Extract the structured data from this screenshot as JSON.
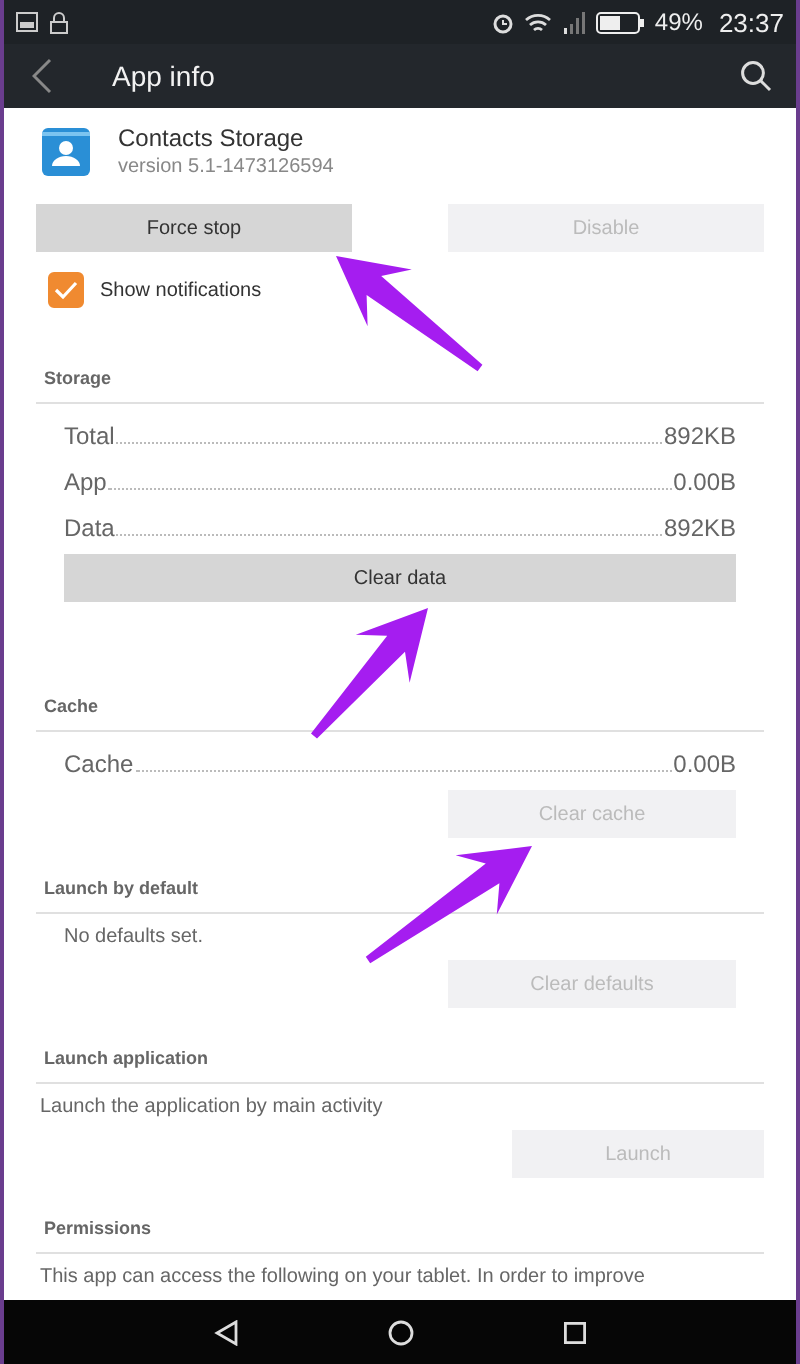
{
  "status_bar": {
    "battery": "49%",
    "time": "23:37"
  },
  "toolbar": {
    "title": "App info"
  },
  "app": {
    "name": "Contacts Storage",
    "version": "version 5.1-1473126594"
  },
  "actions": [
    {
      "label": "Force stop",
      "disabled": false
    },
    {
      "label": "Disable",
      "disabled": true
    }
  ],
  "show_notifications": {
    "label": "Show notifications",
    "checked": true
  },
  "sections": [
    {
      "heading": "Storage",
      "rows": [
        {
          "label": "Total",
          "value": "892KB"
        },
        {
          "label": "App",
          "value": "0.00B"
        },
        {
          "label": "Data",
          "value": "892KB"
        }
      ],
      "button": {
        "label": "Clear data",
        "disabled": false,
        "kind": "wide"
      }
    },
    {
      "heading": "Cache",
      "rows": [
        {
          "label": "Cache",
          "value": "0.00B"
        }
      ],
      "button": {
        "label": "Clear cache",
        "disabled": true,
        "kind": "small"
      }
    },
    {
      "heading": "Launch by default",
      "text": "No defaults set.",
      "button": {
        "label": "Clear defaults",
        "disabled": true,
        "kind": "small"
      }
    },
    {
      "heading": "Launch application",
      "text": "Launch the application by main activity",
      "button": {
        "label": "Launch",
        "disabled": true,
        "kind": "small"
      }
    },
    {
      "heading": "Permissions",
      "text": "This app can access the following on your tablet. In order to improve"
    }
  ]
}
